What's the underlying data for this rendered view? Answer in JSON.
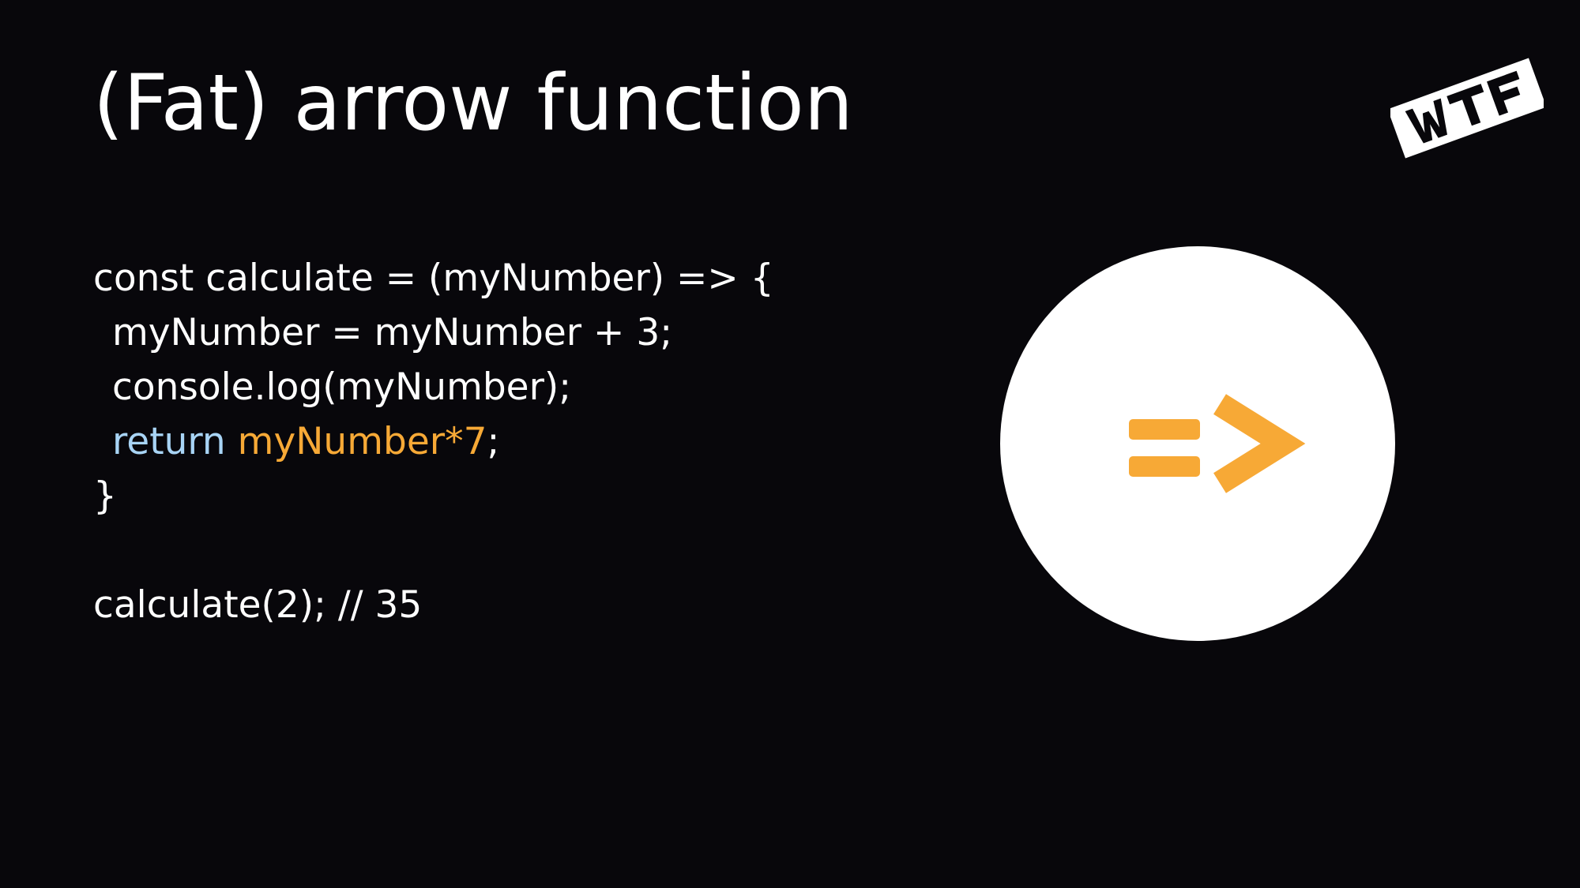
{
  "slide": {
    "title": "(Fat) arrow function",
    "logo_icon": "wtf-logo-icon",
    "badge_icon": "fat-arrow-icon",
    "colors": {
      "background": "#08070b",
      "text": "#ffffff",
      "keyword": "#a8d4f5",
      "highlight": "#f7a936",
      "badge": "#ffffff"
    }
  },
  "code": {
    "line1": "const calculate = (myNumber) => {",
    "line2": "myNumber = myNumber + 3;",
    "line3": "console.log(myNumber);",
    "line4_keyword": "return",
    "line4_space": " ",
    "line4_expression": "myNumber*7",
    "line4_end": ";",
    "line5": "}",
    "line7": "calculate(2); // 35"
  }
}
